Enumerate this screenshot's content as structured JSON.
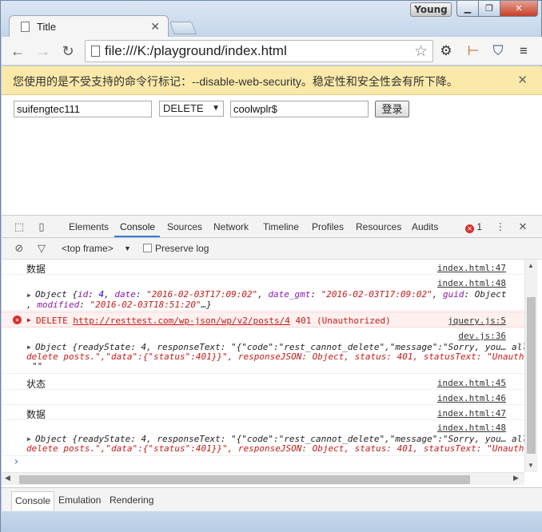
{
  "window": {
    "user": "Young",
    "minimize": "▁",
    "maximize": "❐",
    "close": "✕"
  },
  "tab": {
    "title": "Title",
    "close": "✕"
  },
  "toolbar": {
    "url": "file:///K:/playground/index.html"
  },
  "infobar": {
    "message": "您使用的是不受支持的命令行标记：--disable-web-security。稳定性和安全性会有所下降。",
    "close": "✕"
  },
  "page": {
    "username_value": "suifengtec111",
    "method_selected": "DELETE",
    "password_value": "coolwplr$",
    "login_label": "登录"
  },
  "devtools": {
    "tabs": [
      "Elements",
      "Console",
      "Sources",
      "Network",
      "Timeline",
      "Profiles",
      "Resources",
      "Audits"
    ],
    "error_count": "1",
    "frame": "<top frame>",
    "preserve_log": "Preserve log",
    "drawer_tabs": [
      "Console",
      "Emulation",
      "Rendering"
    ]
  },
  "console": {
    "r1_text": "数据",
    "r1_src": "index.html:47",
    "r2_src": "index.html:48",
    "r2_line1_pre": "Object {",
    "r2_line1_a": "id",
    "r2_line1_b": ": ",
    "r2_line1_c": "4",
    "r2_line1_d": ", ",
    "r2_line1_e": "date",
    "r2_line1_f": ": ",
    "r2_line1_g": "\"2016-02-03T17:09:02\"",
    "r2_line1_h": ", ",
    "r2_line1_i": "date_gmt",
    "r2_line1_j": ": ",
    "r2_line1_k": "\"2016-02-03T17:09:02\"",
    "r2_line1_l": ", ",
    "r2_line1_m": "guid",
    "r2_line1_n": ": Object",
    "r2_line2_a": ", ",
    "r2_line2_b": "modified",
    "r2_line2_c": ": ",
    "r2_line2_d": "\"2016-02-03T18:51:20\"",
    "r2_line2_e": "…}",
    "err_text_pre": "DELETE ",
    "err_url": "http://resttest.com/wp-json/wp/v2/posts/4",
    "err_text_post": " 401 (Unauthorized)",
    "err_src": "jquery.js:5",
    "r4_src": "dev.js:36",
    "r4_line1": "Object {readyState: 4, responseText: \"{\"code\":\"rest_cannot_delete\",\"message\":\"Sorry, you… all",
    "r4_line2": "delete posts.\",\"data\":{\"status\":401}}\", responseJSON: Object, status: 401, statusText: \"Unauth",
    "r4_line3": "\"\"",
    "r5_text": "状态",
    "r5_src": "index.html:45",
    "r6_src": "index.html:46",
    "r7_text": "数据",
    "r7_src": "index.html:47",
    "r8_src": "index.html:48",
    "r8_line1": "Object {readyState: 4, responseText: \"{\"code\":\"rest_cannot_delete\",\"message\":\"Sorry, you… all",
    "r8_line2": "delete posts.\",\"data\":{\"status\":401}}\", responseJSON: Object, status: 401, statusText: \"Unauth"
  }
}
